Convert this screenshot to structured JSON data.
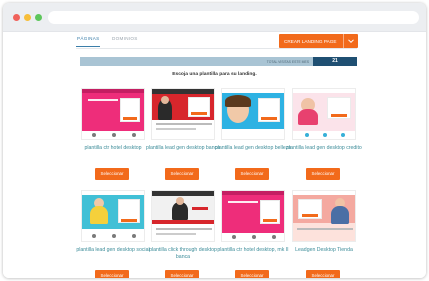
{
  "tabs": [
    {
      "label": "PÁGINAS",
      "active": true
    },
    {
      "label": "DOMINIOS",
      "active": false
    }
  ],
  "create_button": {
    "label": "CREAR LANDING PAGE",
    "icon": "chevron-down-icon"
  },
  "visits": {
    "label": "TOTAL VISITAS ESTE MES",
    "count": "21"
  },
  "prompt": "Escoja una plantilla para su landing.",
  "select_label": "Seleccionar",
  "templates": [
    {
      "title": "plantilla ctr hotel desktop",
      "theme": "#ee2d7a"
    },
    {
      "title": "plantilla lead gen desktop banca",
      "theme": "#d7262c"
    },
    {
      "title": "plantilla lead gen desktop belleza",
      "theme": "#2eb2e3"
    },
    {
      "title": "plantilla lead gen desktop credito",
      "theme": "#f7d7e2"
    },
    {
      "title": "plantilla lead gen desktop social",
      "theme": "#41c0d6"
    },
    {
      "title": "plantilla click through desktop banca",
      "theme": "#d7262c"
    },
    {
      "title": "plantilla ctr hotel desktop, mk II",
      "theme": "#ee2d7a"
    },
    {
      "title": "Leadgen Desktop Tienda",
      "theme": "#f4a9a0"
    }
  ],
  "colors": {
    "accent": "#f26a1b",
    "link": "#3c8c99",
    "tab_active": "#3b7ea9",
    "visits_bar": "#a9c4d4",
    "visits_count": "#1f4f72"
  }
}
